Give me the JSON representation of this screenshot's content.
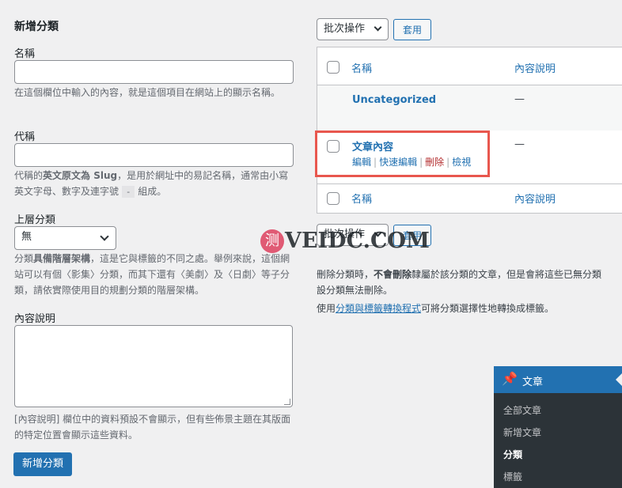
{
  "form": {
    "title": "新增分類",
    "name_label": "名稱",
    "name_value": "",
    "name_help": "在這個欄位中輸入的內容，就是這個項目在網站上的顯示名稱。",
    "slug_label": "代稱",
    "slug_value": "",
    "slug_help_prefix": "代稱的",
    "slug_help_bold": "英文原文為 Slug",
    "slug_help_mid": "，是用於網址中的易記名稱，通常由小寫英文字母、數字及連字號",
    "slug_help_code": "-",
    "slug_help_suffix": "組成。",
    "parent_label": "上層分類",
    "parent_selected": "無",
    "parent_help_prefix": "分類",
    "parent_help_bold": "具備階層架構",
    "parent_help_suffix": "，這是它與標籤的不同之處。舉例來說，這個網站可以有個〈影集〉分類，而其下還有〈美劇〉及〈日劇〉等子分類，請依實際使用目的規劃分類的階層架構。",
    "desc_label": "內容說明",
    "desc_value": "",
    "desc_help": "[內容說明] 欄位中的資料預設不會顯示，但有些佈景主題在其版面的特定位置會顯示這些資料。",
    "submit_label": "新增分類"
  },
  "bulk_top": {
    "selected": "批次操作",
    "apply": "套用"
  },
  "bulk_bottom": {
    "selected": "批次操作",
    "apply": "套用"
  },
  "table": {
    "col_name": "名稱",
    "col_desc": "內容說明",
    "rows": [
      {
        "name": "Uncategorized",
        "desc": "—"
      },
      {
        "name": "文章內容",
        "desc": "—",
        "actions": {
          "edit": "編輯",
          "quick_edit": "快速編輯",
          "delete": "刪除",
          "view": "檢視"
        }
      }
    ]
  },
  "notes": {
    "delete_prefix": "刪除分類時，",
    "delete_bold": "不會刪除",
    "delete_suffix": "隸屬於該分類的文章，但是會將這些已無分類的文章重新指派給預設分類無法刪除。",
    "delete_line1": "隸屬於該分類的文章，但是會將這些已無分類",
    "delete_line2": "設分類無法刪除。",
    "convert_prefix": "使用",
    "convert_link": "分類與標籤轉換程式",
    "convert_suffix": "可將分類選擇性地轉換成標籤。"
  },
  "admin_menu": {
    "top": "文章",
    "items": [
      "全部文章",
      "新增文章",
      "分類",
      "標籤"
    ],
    "current_index": 2
  },
  "watermark": {
    "icon_text": "测",
    "text": "VEIDC.COM"
  },
  "colors": {
    "accent": "#2271b1",
    "highlight_box": "#e8574e",
    "delete": "#b32d2e",
    "menu_bg": "#2c3338"
  }
}
